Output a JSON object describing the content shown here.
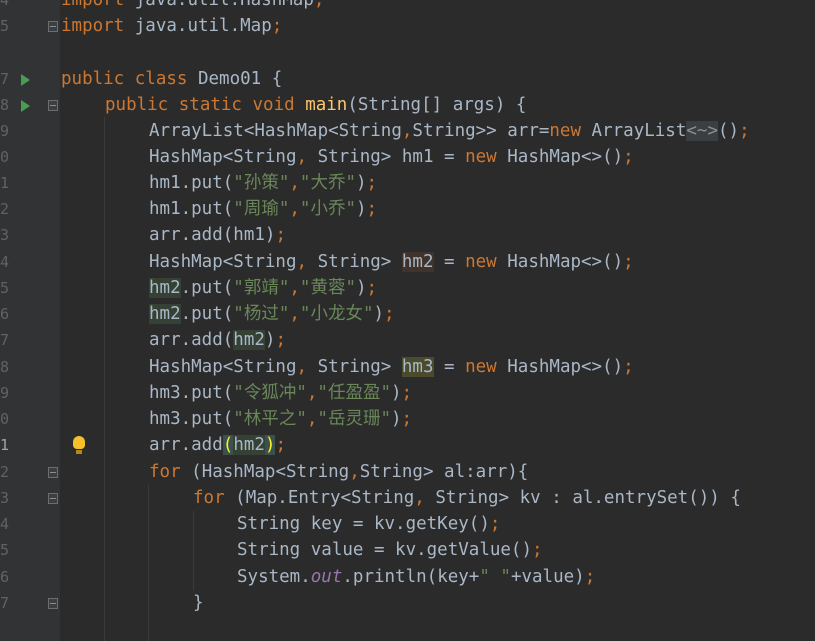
{
  "gutter": {
    "line_numbers": [
      "4",
      "5",
      "",
      "7",
      "8",
      "9",
      "0",
      "1",
      "2",
      "3",
      "4",
      "5",
      "6",
      "7",
      "8",
      "9",
      "0",
      "1",
      "2",
      "3",
      "4",
      "5",
      "6",
      "7",
      ""
    ]
  },
  "code": {
    "l4": {
      "a": "import ",
      "b": "java.util.HashMap",
      "c": ";"
    },
    "l5": {
      "a": "import ",
      "b": "java.util.Map",
      "c": ";"
    },
    "l7": {
      "a": "public class ",
      "b": "Demo01 {"
    },
    "l8": {
      "a": "public static void ",
      "b": "main",
      "c": "(String[] args) {"
    },
    "l9": {
      "a": "ArrayList<HashMap<String",
      "b": ",",
      "c": "String>> arr=",
      "d": "new ",
      "e": "ArrayList",
      "f": "<~>",
      "g": "()",
      "h": ";"
    },
    "l10": {
      "a": "HashMap<String",
      "b": ", ",
      "c": "String> hm1 = ",
      "d": "new ",
      "e": "HashMap<>()",
      "f": ";"
    },
    "l11": {
      "a": "hm1.put(",
      "b": "\"孙策\"",
      "c": ",",
      "d": "\"大乔\"",
      "e": ")",
      "f": ";"
    },
    "l12": {
      "a": "hm1.put(",
      "b": "\"周瑜\"",
      "c": ",",
      "d": "\"小乔\"",
      "e": ")",
      "f": ";"
    },
    "l13": {
      "a": "arr.add(hm1)",
      "b": ";"
    },
    "l14": {
      "a": "HashMap<String",
      "b": ", ",
      "c": "String> ",
      "d": "hm2",
      "e": " = ",
      "f": "new ",
      "g": "HashMap<>()",
      "h": ";"
    },
    "l15": {
      "a": "hm2",
      "b": ".put(",
      "c": "\"郭靖\"",
      "d": ",",
      "e": "\"黄蓉\"",
      "f": ")",
      "g": ";"
    },
    "l16": {
      "a": "hm2",
      "b": ".put(",
      "c": "\"杨过\"",
      "d": ",",
      "e": "\"小龙女\"",
      "f": ")",
      "g": ";"
    },
    "l17": {
      "a": "arr.add(",
      "b": "hm2",
      "c": ")",
      "d": ";"
    },
    "l18": {
      "a": "HashMap<String",
      "b": ", ",
      "c": "String> ",
      "d": "hm3",
      "e": " = ",
      "f": "new ",
      "g": "HashMap<>()",
      "h": ";"
    },
    "l19": {
      "a": "hm3.put(",
      "b": "\"令狐冲\"",
      "c": ",",
      "d": "\"任盈盈\"",
      "e": ")",
      "f": ";"
    },
    "l20": {
      "a": "hm3.put(",
      "b": "\"林平之\"",
      "c": ",",
      "d": "\"岳灵珊\"",
      "e": ")",
      "f": ";"
    },
    "l21": {
      "a": "arr.add",
      "b": "(",
      "c": "hm2",
      "d": ")",
      "e": ";"
    },
    "l22": {
      "a": "for ",
      "b": "(HashMap<String",
      "c": ",",
      "d": "String> al:arr){"
    },
    "l23": {
      "a": "for ",
      "b": "(Map.Entry<String",
      "c": ", ",
      "d": "String> kv : al.entrySet()) {"
    },
    "l24": {
      "a": "String key = kv.getKey()",
      "b": ";"
    },
    "l25": {
      "a": "String value = kv.getValue()",
      "b": ";"
    },
    "l26": {
      "a": "System.",
      "b": "out",
      "c": ".println(key+",
      "d": "\" \"",
      "e": "+value)",
      "f": ";"
    },
    "l27": {
      "a": "}"
    }
  },
  "colors": {
    "background": "#2b2b2b",
    "gutter": "#313335",
    "keyword": "#cc7832",
    "identifier": "#a9b7c6",
    "string": "#6a8759",
    "method": "#ffc66d",
    "field": "#9876aa"
  },
  "icons": [
    "run-icon",
    "fold-icon",
    "bulb-icon"
  ]
}
